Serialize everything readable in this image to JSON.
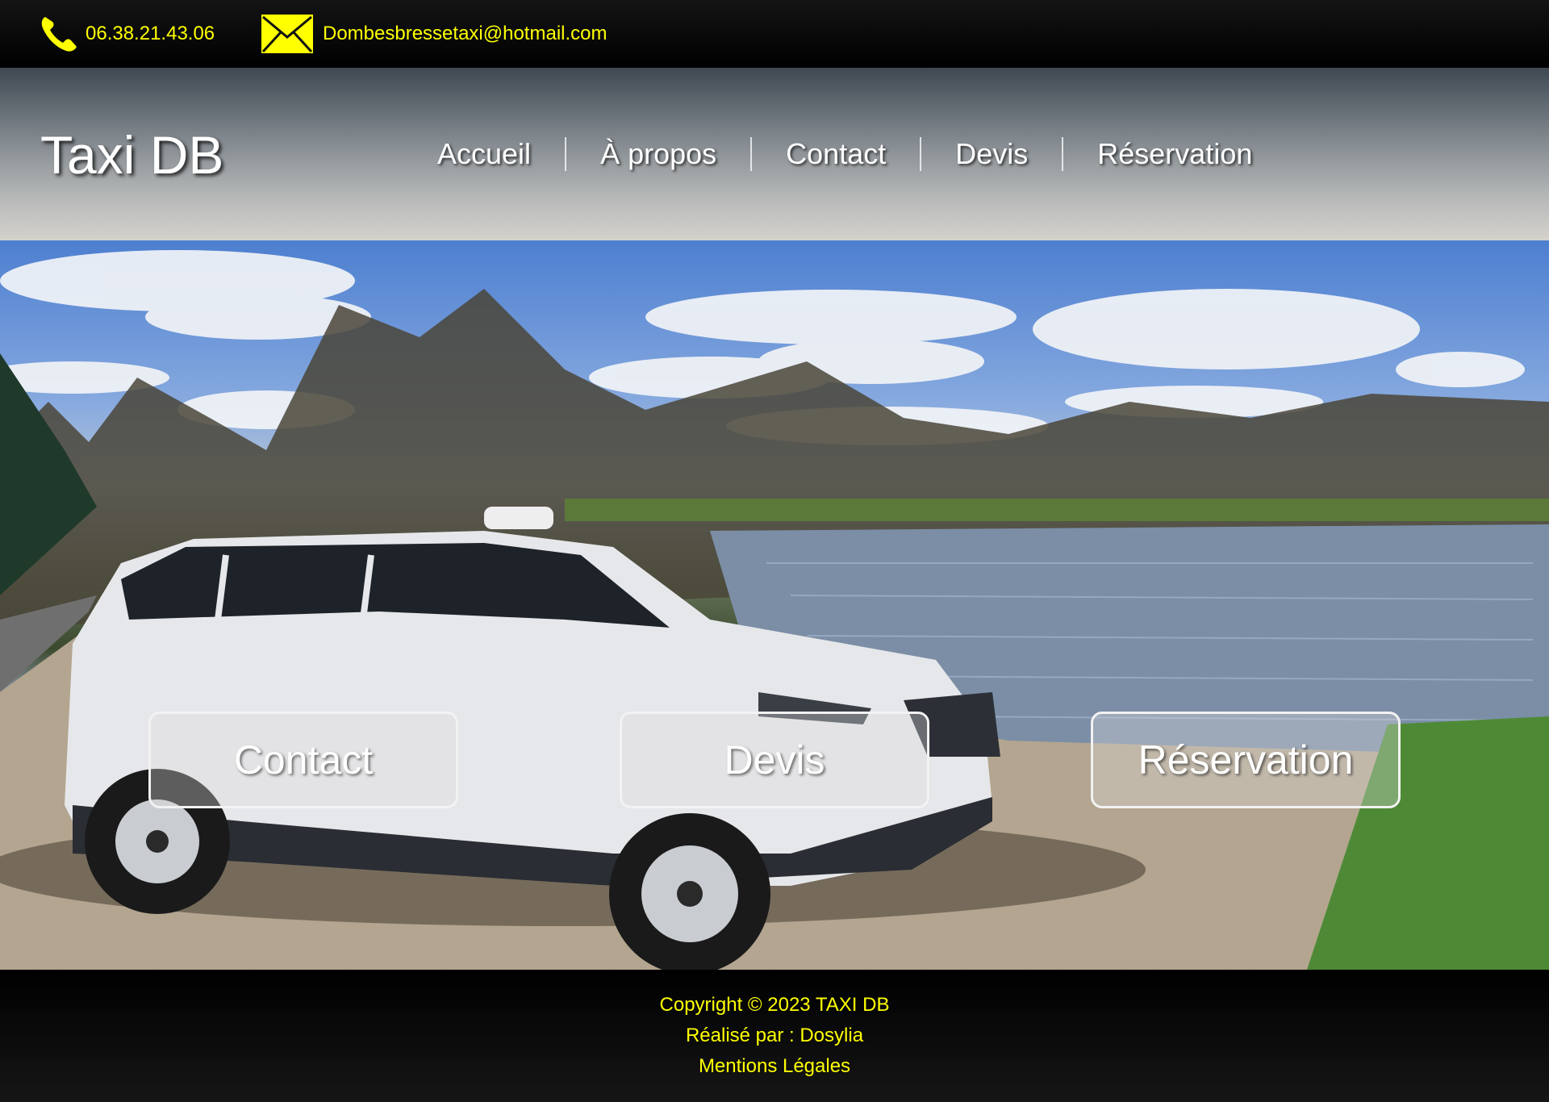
{
  "topbar": {
    "phone": "06.38.21.43.06",
    "email": "Dombesbressetaxi@hotmail.com",
    "accent_color": "#ffff00",
    "icons": [
      "phone-icon",
      "envelope-icon"
    ]
  },
  "header": {
    "logo": "Taxi DB",
    "nav": [
      "Accueil",
      "À propos",
      "Contact",
      "Devis",
      "Réservation"
    ]
  },
  "hero": {
    "buttons": [
      "Contact",
      "Devis",
      "Réservation"
    ]
  },
  "footer": {
    "copyright": "Copyright © 2023 TAXI DB",
    "credit": "Réalisé par : Dosylia",
    "legal": "Mentions Légales"
  }
}
